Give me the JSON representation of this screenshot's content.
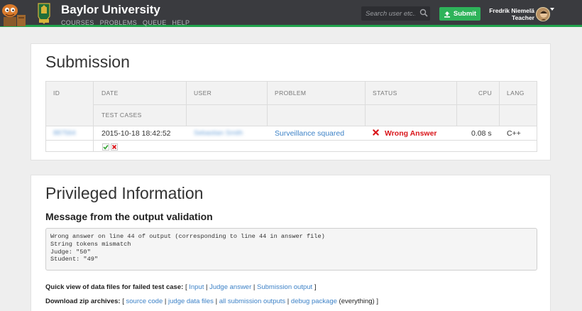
{
  "navbar": {
    "brand": "Baylor University",
    "links": [
      "COURSES",
      "PROBLEMS",
      "QUEUE",
      "HELP"
    ],
    "search_placeholder": "Search user etc...",
    "submit_label": "Submit",
    "user_name": "Fredrik Niemelä",
    "user_role": "Teacher"
  },
  "submission": {
    "title": "Submission",
    "headers": {
      "id": "ID",
      "date": "DATE",
      "user": "USER",
      "problem": "PROBLEM",
      "status": "STATUS",
      "cpu": "CPU",
      "lang": "LANG",
      "test_cases": "TEST CASES"
    },
    "row": {
      "id": "887564",
      "date": "2015-10-18 18:42:52",
      "user": "Sebastian Smith",
      "problem": "Surveillance squared",
      "status": "Wrong Answer",
      "cpu": "0.08 s",
      "lang": "C++"
    },
    "test_case_results": [
      "accepted",
      "wrong"
    ]
  },
  "privileged": {
    "title": "Privileged Information",
    "message_heading": "Message from the output validation",
    "message_lines": [
      "Wrong answer on line 44 of output (corresponding to line 44 in answer file)",
      "String tokens mismatch",
      "Judge: \"50\"",
      "Student: \"49\""
    ],
    "quick_view": {
      "label": "Quick view of data files for failed test case:",
      "open": "[",
      "links": [
        "Input",
        "Judge answer",
        "Submission output"
      ],
      "close": "]"
    },
    "download": {
      "label": "Download zip archives:",
      "open": "[",
      "links": [
        "source code",
        "judge data files",
        "all submission outputs",
        "debug package"
      ],
      "suffix": "(everything)",
      "close": "]"
    }
  },
  "colors": {
    "navbar_bg": "#3a3b3f",
    "accent_green": "#2eb35a",
    "link_blue": "#3d82c7",
    "error_red": "#d9151a"
  }
}
